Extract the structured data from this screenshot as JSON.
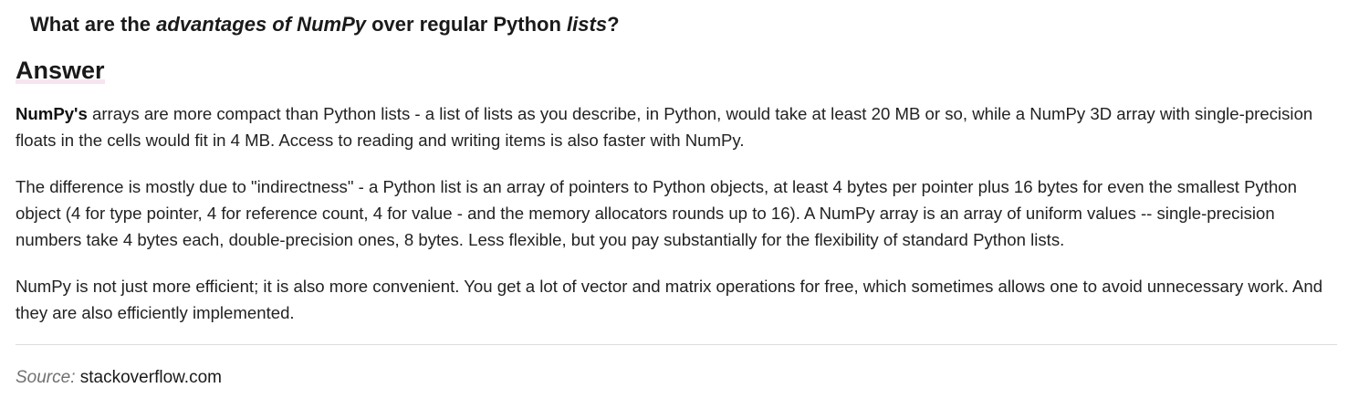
{
  "question": {
    "part1": "What are the ",
    "em1": "advantages of NumPy",
    "part2": " over regular Python ",
    "em2": "lists",
    "part3": "?"
  },
  "answer": {
    "heading": "Answer",
    "paragraphs": [
      {
        "bold_lead": "NumPy's",
        "text": " arrays are more compact than Python lists - a list of lists as you describe, in Python, would take at least 20 MB or so, while a NumPy 3D array with single-precision floats in the cells would fit in 4 MB. Access to reading and writing items is also faster with NumPy."
      },
      {
        "text": "The difference is mostly due to \"indirectness\" - a Python list is an array of pointers to Python objects, at least 4 bytes per pointer plus 16 bytes for even the smallest Python object (4 for type pointer, 4 for reference count, 4 for value - and the memory allocators rounds up to 16). A NumPy array is an array of uniform values -- single-precision numbers take 4 bytes each, double-precision ones, 8 bytes. Less flexible, but you pay substantially for the flexibility of standard Python lists."
      },
      {
        "text": "NumPy is not just more efficient; it is also more convenient. You get a lot of vector and matrix operations for free, which sometimes allows one to avoid unnecessary work. And they are also efficiently implemented."
      }
    ]
  },
  "source": {
    "label": "Source:",
    "link_text": "stackoverflow.com"
  }
}
